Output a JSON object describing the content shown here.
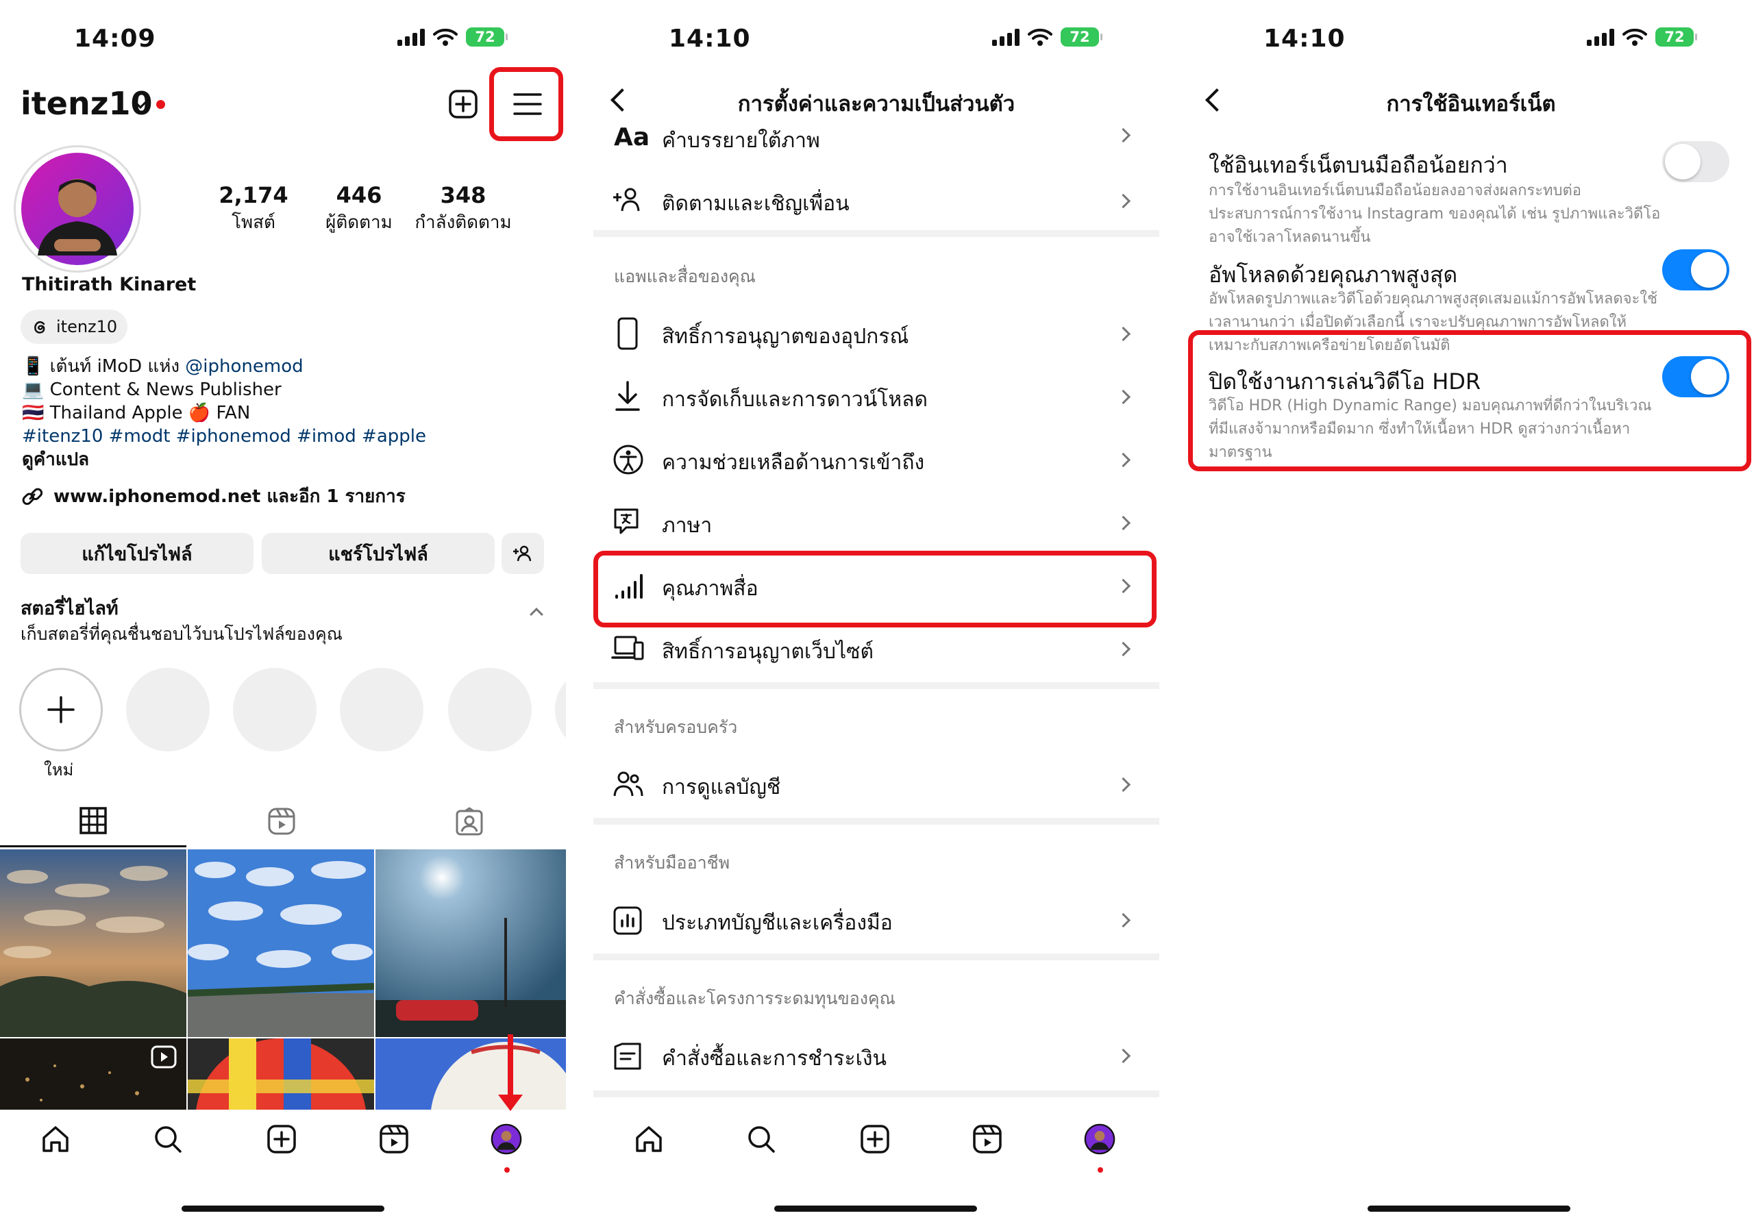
{
  "phone1": {
    "status": {
      "time": "14:09",
      "battery": "72"
    },
    "username": "itenz10",
    "stats": [
      {
        "value": "2,174",
        "label": "โพสต์"
      },
      {
        "value": "446",
        "label": "ผู้ติดตาม"
      },
      {
        "value": "348",
        "label": "กำลังติดตาม"
      }
    ],
    "full_name": "Thitirath Kinaret",
    "threads_handle": "itenz10",
    "bio": {
      "line1_prefix": "📱 เต้นท์ iMoD แห่ง ",
      "line1_mention": "@iphonemod",
      "line2": "💻 Content & News Publisher",
      "line3": "🇹🇭 Thailand Apple 🍎 FAN",
      "hashtags": "#itenz10 #modt #iphonemod #imod #apple",
      "translate": "ดูคำแปล"
    },
    "link": "www.iphonemod.net และอีก 1 รายการ",
    "buttons": {
      "edit": "แก้ไขโปรไฟล์",
      "share": "แชร์โปรไฟล์"
    },
    "highlights": {
      "title": "สตอรี่ไฮไลท์",
      "subtitle": "เก็บสตอรี่ที่คุณชื่นชอบไว้บนโปรไฟล์ของคุณ",
      "new_label": "ใหม่"
    },
    "icons": [
      "add-post-icon",
      "menu-icon",
      "threads-icon",
      "link-icon",
      "add-person-icon",
      "grid-icon",
      "reels-icon",
      "tagged-icon",
      "home-icon",
      "search-icon",
      "create-icon",
      "reels-icon",
      "profile-icon"
    ]
  },
  "phone2": {
    "status": {
      "time": "14:10",
      "battery": "72"
    },
    "title": "การตั้งค่าและความเป็นส่วนตัว",
    "rows": {
      "caption": "คำบรรยายใต้ภาพ",
      "follow": "ติดตามและเชิญเพื่อน",
      "device": "สิทธิ์การอนุญาตของอุปกรณ์",
      "download": "การจัดเก็บและการดาวน์โหลด",
      "access": "ความช่วยเหลือด้านการเข้าถึง",
      "language": "ภาษา",
      "media": "คุณภาพสื่อ",
      "website": "สิทธิ์การอนุญาตเว็บไซต์",
      "supervision": "การดูแลบัญชี",
      "tools": "ประเภทบัญชีและเครื่องมือ",
      "orders": "คำสั่งซื้อและการชำระเงิน"
    },
    "sections": {
      "apps": "แอพและสื่อของคุณ",
      "family": "สำหรับครอบครัว",
      "pro": "สำหรับมืออาชีพ",
      "purchases": "คำสั่งซื้อและโครงการระดมทุนของคุณ"
    }
  },
  "phone3": {
    "status": {
      "time": "14:10",
      "battery": "72"
    },
    "title": "การใช้อินเทอร์เน็ต",
    "settings": [
      {
        "title": "ใช้อินเทอร์เน็ตบนมือถือน้อยกว่า",
        "desc": "การใช้งานอินเทอร์เน็ตบนมือถือน้อยลงอาจส่งผลกระทบต่อประสบการณ์การใช้งาน Instagram ของคุณได้ เช่น รูปภาพและวิดีโออาจใช้เวลาโหลดนานขึ้น",
        "on": false
      },
      {
        "title": "อัพโหลดด้วยคุณภาพสูงสุด",
        "desc": "อัพโหลดรูปภาพและวิดีโอด้วยคุณภาพสูงสุดเสมอแม้การอัพโหลดจะใช้เวลานานกว่า เมื่อปิดตัวเลือกนี้ เราจะปรับคุณภาพการอัพโหลดให้เหมาะกับสภาพเครือข่ายโดยอัตโนมัติ",
        "on": true
      },
      {
        "title": "ปิดใช้งานการเล่นวิดีโอ HDR",
        "desc": "วิดีโอ HDR (High Dynamic Range) มอบคุณภาพที่ดีกว่าในบริเวณที่มีแสงจ้ามากหรือมืดมาก ซึ่งทำให้เนื้อหา HDR ดูสว่างกว่าเนื้อหามาตรฐาน",
        "on": true
      }
    ]
  },
  "colors": {
    "highlight": "#e8141b",
    "toggle_on": "#0a84ff",
    "link": "#00376b",
    "battery": "#34c759"
  }
}
